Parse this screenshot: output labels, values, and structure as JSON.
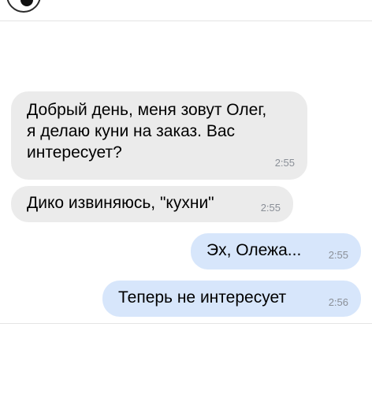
{
  "header": {
    "avatar_icon": "avatar-icon"
  },
  "messages": [
    {
      "direction": "incoming",
      "text": "Добрый день, меня зовут Олег,\nя делаю куни на заказ. Вас\nинтересует?",
      "time": "2:55"
    },
    {
      "direction": "incoming",
      "text": "Дико извиняюсь, \"кухни\"",
      "time": "2:55"
    },
    {
      "direction": "outgoing",
      "text": "Эх, Олежа...",
      "time": "2:55"
    },
    {
      "direction": "outgoing",
      "text": "Теперь не интересует",
      "time": "2:56"
    }
  ],
  "colors": {
    "incoming_bubble": "#ebebeb",
    "outgoing_bubble": "#d7e6fb",
    "time_text": "#8a8f97"
  }
}
